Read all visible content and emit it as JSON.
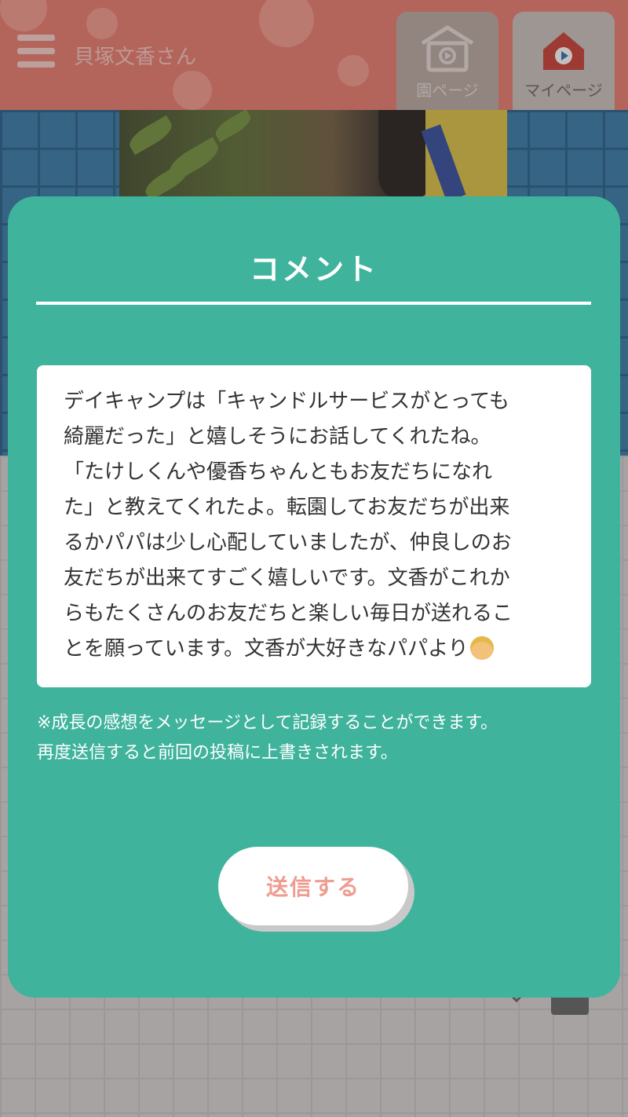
{
  "header": {
    "user_name": "貝塚文香さん",
    "nav": [
      {
        "label": "園ページ",
        "icon": "school-house-icon"
      },
      {
        "label": "マイページ",
        "icon": "home-video-icon"
      }
    ]
  },
  "modal": {
    "title": "コメント",
    "comment_lines": [
      "デイキャンプは「キャンドルサービスがとっても",
      "綺麗だった」と嬉しそうにお話してくれたね。",
      "「たけしくんや優香ちゃんともお友だちになれ",
      "た」と教えてくれたよ。転園してお友だちが出来",
      "るかパパは少し心配していましたが、仲良しのお",
      "友だちが出来てすごく嬉しいです。文香がこれか",
      "らもたくさんのお友だちと楽しい毎日が送れるこ",
      "とを願っています。文香が大好きなパパより"
    ],
    "comment_emoji": "man-face-emoji",
    "note_lines": [
      "※成長の感想をメッセージとして記録することができます。",
      "再度送信すると前回の投稿に上書きされます。"
    ],
    "send_label": "送信する"
  },
  "colors": {
    "header": "#e77a6c",
    "modal": "#3fb39c",
    "send_text": "#ef9c90"
  }
}
